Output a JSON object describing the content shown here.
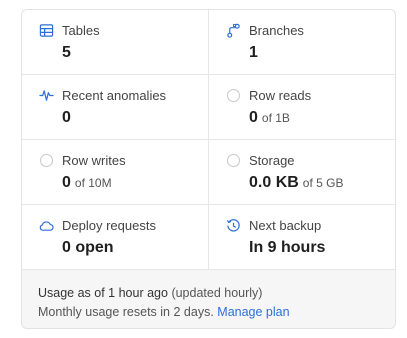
{
  "metrics": [
    {
      "key": "tables",
      "label": "Tables",
      "value": "5",
      "sub": "",
      "icon": "table-icon"
    },
    {
      "key": "branches",
      "label": "Branches",
      "value": "1",
      "sub": "",
      "icon": "branch-icon"
    },
    {
      "key": "anomalies",
      "label": "Recent anomalies",
      "value": "0",
      "sub": "",
      "icon": "pulse-icon"
    },
    {
      "key": "row-reads",
      "label": "Row reads",
      "value": "0",
      "sub": "of 1B",
      "icon": "progress-ring-icon"
    },
    {
      "key": "row-writes",
      "label": "Row writes",
      "value": "0",
      "sub": "of 10M",
      "icon": "progress-ring-icon"
    },
    {
      "key": "storage",
      "label": "Storage",
      "value": "0.0 KB",
      "sub": "of 5 GB",
      "icon": "progress-ring-icon"
    },
    {
      "key": "deploy-requests",
      "label": "Deploy requests",
      "value": "0 open",
      "sub": "",
      "icon": "cloud-icon"
    },
    {
      "key": "next-backup",
      "label": "Next backup",
      "value": "In 9 hours",
      "sub": "",
      "icon": "history-clock-icon"
    }
  ],
  "footer": {
    "usage_prefix": "Usage as of 1 hour ago",
    "usage_suffix": "(updated hourly)",
    "reset_text": "Monthly usage resets in 2 days.",
    "manage_link": "Manage plan"
  },
  "colors": {
    "icon": "#2f6ed8",
    "link": "#2f6ed8",
    "ring": "#c8c8c8",
    "footer_bg": "#f6f6f6"
  }
}
